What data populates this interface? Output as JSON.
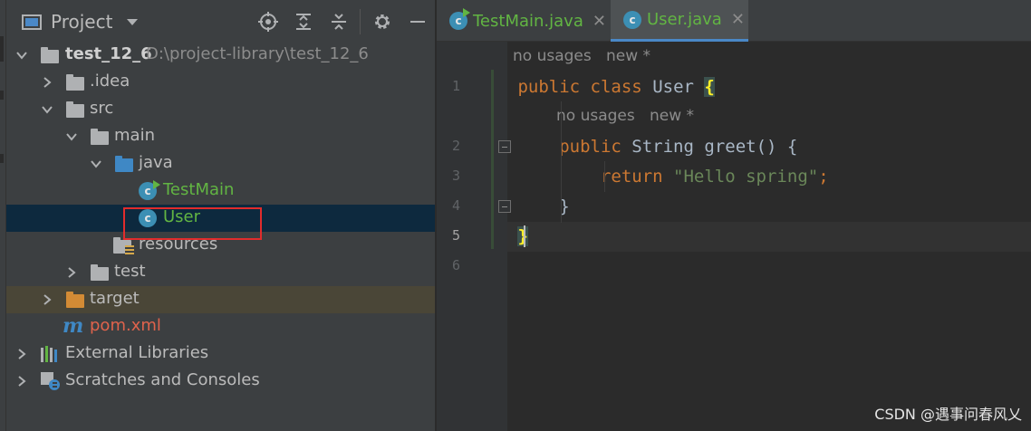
{
  "project_panel": {
    "title": "Project",
    "tools": [
      "locate-icon",
      "expand-all-icon",
      "collapse-all-icon",
      "gear-icon",
      "hide-icon"
    ],
    "tree": [
      {
        "label": "test_12_6",
        "path": "D:\\project-library\\test_12_6",
        "icon": "module-folder-icon",
        "expanded": true
      },
      {
        "label": ".idea",
        "icon": "folder-icon",
        "expanded": false
      },
      {
        "label": "src",
        "icon": "folder-icon",
        "expanded": true
      },
      {
        "label": "main",
        "icon": "folder-icon",
        "expanded": true
      },
      {
        "label": "java",
        "icon": "source-folder-icon",
        "expanded": true
      },
      {
        "label": "TestMain",
        "icon": "runnable-class-icon"
      },
      {
        "label": "User",
        "icon": "class-icon",
        "selected": true
      },
      {
        "label": "resources",
        "icon": "resources-folder-icon"
      },
      {
        "label": "test",
        "icon": "folder-icon",
        "expanded": false
      },
      {
        "label": "target",
        "icon": "excluded-folder-icon",
        "expanded": false
      },
      {
        "label": "pom.xml",
        "icon": "maven-icon"
      },
      {
        "label": "External Libraries",
        "icon": "libraries-icon",
        "expanded": false
      },
      {
        "label": "Scratches and Consoles",
        "icon": "scratches-icon",
        "expanded": false
      }
    ]
  },
  "editor": {
    "tabs": [
      {
        "label": "TestMain.java",
        "icon": "runnable-class-icon",
        "active": false
      },
      {
        "label": "User.java",
        "icon": "class-icon",
        "active": true
      }
    ],
    "hints": [
      {
        "usages": "no usages",
        "author": "new *"
      },
      {
        "usages": "no usages",
        "author": "new *"
      }
    ],
    "line_numbers": [
      "1",
      "2",
      "3",
      "4",
      "5",
      "6"
    ],
    "current_line": "5",
    "code": {
      "kw_public": "public",
      "kw_class": "class",
      "class_name": "User",
      "open_brace": "{",
      "type_string": "String",
      "method_name": "greet",
      "method_parens": "() {",
      "kw_return": "return",
      "string_literal": "\"Hello spring\"",
      "semicolon": ";",
      "close_brace": "}"
    }
  },
  "colors": {
    "keyword": "#cc7832",
    "string": "#6a8759",
    "identifier": "#a9b7c6",
    "selection": "#0d293e",
    "highlight_box": "#e12c2c"
  },
  "watermark": "CSDN @遇事问春风乂"
}
